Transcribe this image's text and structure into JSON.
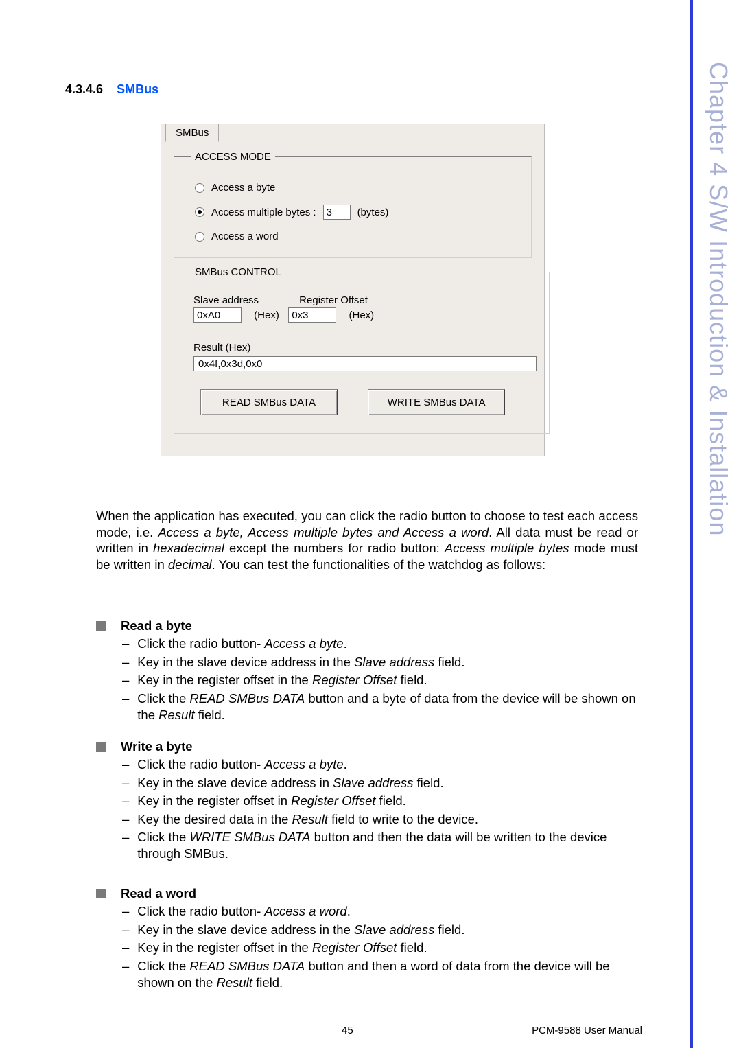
{
  "section": {
    "number": "4.3.4.6",
    "title": "SMBus"
  },
  "sideTab": "Chapter 4   S/W Introduction & Installation",
  "footer": {
    "page": "45",
    "manual": "PCM-9588 User Manual"
  },
  "panel": {
    "tab": "SMBus",
    "accessMode": {
      "legend": "ACCESS MODE",
      "options": {
        "byte": "Access a byte",
        "multi": "Access multiple bytes :",
        "word": "Access a word"
      },
      "multiValue": "3",
      "multiUnit": "(bytes)"
    },
    "control": {
      "legend": "SMBus CONTROL",
      "slaveLabel": "Slave address",
      "regLabel": "Register Offset",
      "slaveValue": "0xA0",
      "regValue": "0x3",
      "hex1": "(Hex)",
      "hex2": "(Hex)",
      "resultLabel": "Result (Hex)",
      "resultValue": "0x4f,0x3d,0x0",
      "readBtn": "READ SMBus DATA",
      "writeBtn": "WRITE SMBus DATA"
    }
  },
  "para": {
    "p1a": "When the application has executed, you can click the radio button to choose to test each access mode, i.e. ",
    "p1i1": "Access a byte, Access multiple bytes and Access a word",
    "p1b": ". All data must be read or written in ",
    "p1i2": "hexadecimal",
    "p1c": " except the numbers for radio button: ",
    "p1i3": "Access multiple bytes",
    "p1d": " mode must be written in ",
    "p1i4": "decimal",
    "p1e": ". You can test the functionalities of the watchdog as follows:"
  },
  "readByte": {
    "title": "Read a byte",
    "i1a": "Click the radio button- ",
    "i1b": "Access a byte",
    "i1c": ".",
    "i2a": "Key in the slave device address in the ",
    "i2b": "Slave address",
    "i2c": " field.",
    "i3a": "Key in the register offset in the ",
    "i3b": "Register Offset",
    "i3c": " field.",
    "i4a": "Click the ",
    "i4b": "READ SMBus DATA",
    "i4c": " button and a byte of data from the device will be shown on the ",
    "i4d": "Result",
    "i4e": " field."
  },
  "writeByte": {
    "title": "Write a byte",
    "i1a": "Click the radio button- ",
    "i1b": "Access a byte",
    "i1c": ".",
    "i2a": "Key in the slave device address in ",
    "i2b": "Slave address",
    "i2c": " field.",
    "i3a": "Key in the register offset in ",
    "i3b": "Register Offset",
    "i3c": " field.",
    "i4a": "Key the desired data in the ",
    "i4b": "Result",
    "i4c": " field to write to the device.",
    "i5a": "Click the ",
    "i5b": "WRITE SMBus DATA",
    "i5c": " button and then the data will be written to the device through SMBus."
  },
  "readWord": {
    "title": "Read a word",
    "i1a": "Click the radio button- ",
    "i1b": "Access a word",
    "i1c": ".",
    "i2a": "Key in the slave device address in the ",
    "i2b": "Slave address",
    "i2c": " field.",
    "i3a": "Key in the register offset in the ",
    "i3b": "Register Offset",
    "i3c": " field.",
    "i4a": "Click the ",
    "i4b": "READ SMBus DATA",
    "i4c": " button and then a word of data from the device will be shown on the ",
    "i4d": "Result",
    "i4e": " field."
  }
}
